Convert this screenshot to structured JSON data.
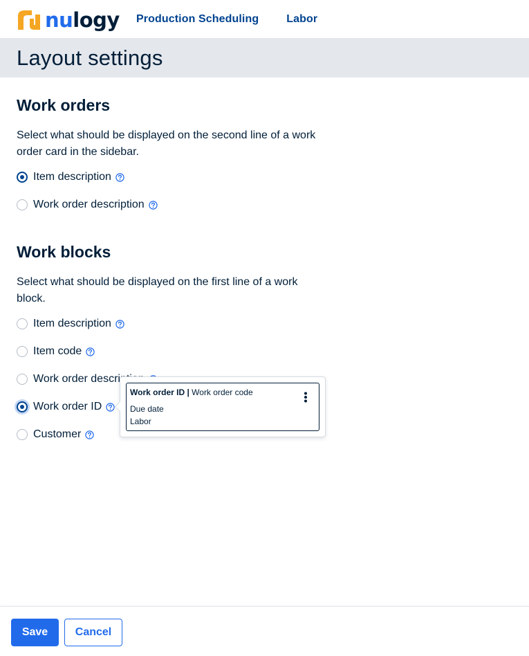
{
  "app": {
    "logo_nu": "nu",
    "logo_logy": "logy",
    "nav": [
      {
        "label": "Production Scheduling"
      },
      {
        "label": "Labor"
      }
    ]
  },
  "page": {
    "title": "Layout settings"
  },
  "work_orders": {
    "title": "Work orders",
    "description": "Select what should be displayed on the second line of a work order card in the sidebar.",
    "options": [
      {
        "label": "Item description",
        "checked": true
      },
      {
        "label": "Work order description",
        "checked": false
      }
    ]
  },
  "work_blocks": {
    "title": "Work blocks",
    "description": "Select what should be displayed on the first line of a work block.",
    "options": [
      {
        "label": "Item description",
        "checked": false
      },
      {
        "label": "Item code",
        "checked": false
      },
      {
        "label": "Work order description",
        "checked": false
      },
      {
        "label": "Work order ID",
        "checked": true
      },
      {
        "label": "Customer",
        "checked": false
      }
    ]
  },
  "tooltip_preview": {
    "bold_text": "Work order ID",
    "separator": " | ",
    "regular_text": "Work order code",
    "line2": "Due date",
    "line3": "Labor",
    "menu_icon": "kebab-vertical-icon"
  },
  "footer": {
    "save_label": "Save",
    "cancel_label": "Cancel"
  },
  "colors": {
    "primary": "#216beb",
    "dark_blue": "#00438f",
    "text": "#011e38",
    "header_bg": "#e4e7ec",
    "logo_orange": "#f5a623"
  },
  "icons": {
    "logo_mark": "nulogy-bracket-icon",
    "help": "help-circle-icon"
  }
}
